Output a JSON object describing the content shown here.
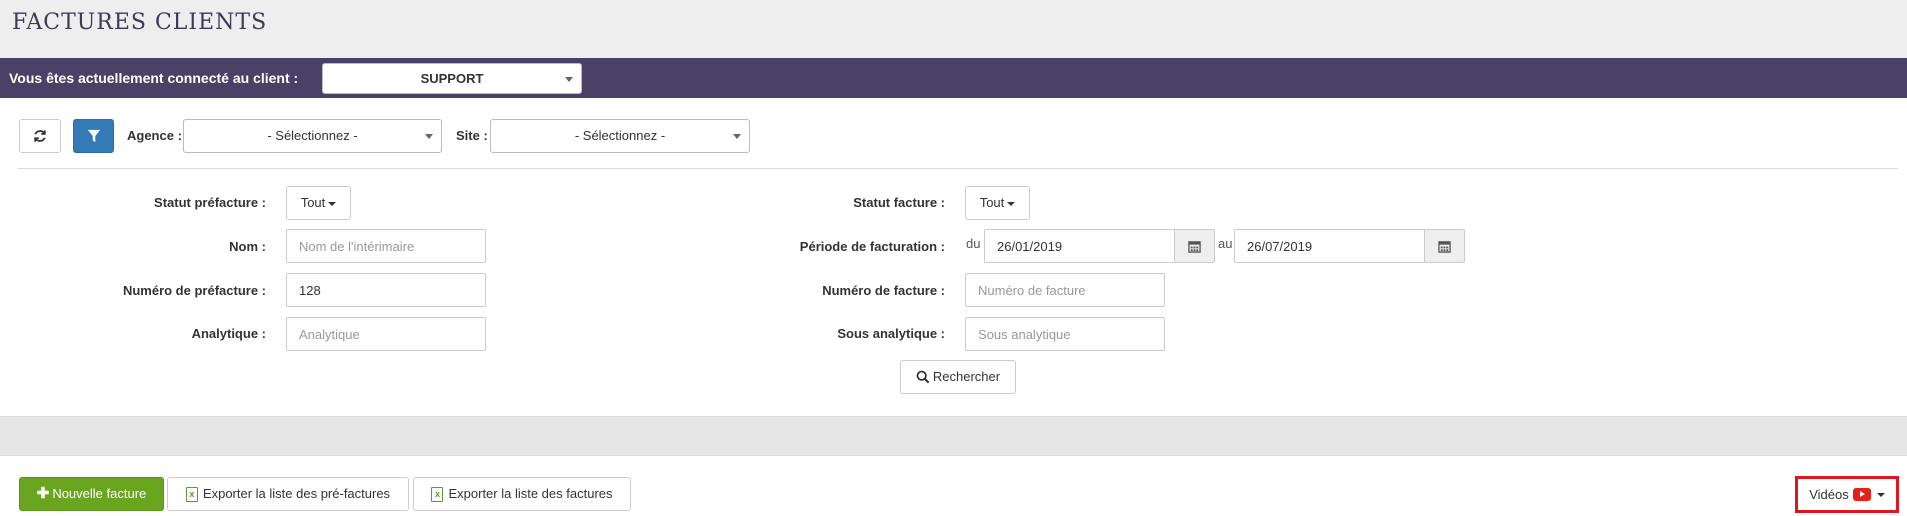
{
  "header": {
    "title": "FACTURES CLIENTS"
  },
  "client_bar": {
    "label": "Vous êtes actuellement connecté au client :",
    "client": "SUPPORT"
  },
  "toolbar": {
    "refresh_icon": "refresh-icon",
    "filter_icon": "filter-icon",
    "agence_label": "Agence :",
    "agence_value": "- Sélectionnez -",
    "site_label": "Site :",
    "site_value": "- Sélectionnez -"
  },
  "filters": {
    "statut_prefacture_label": "Statut préfacture :",
    "statut_prefacture_value": "Tout",
    "nom_label": "Nom :",
    "nom_placeholder": "Nom de l'intérimaire",
    "numero_prefacture_label": "Numéro de préfacture :",
    "numero_prefacture_value": "128",
    "analytique_label": "Analytique :",
    "analytique_placeholder": "Analytique",
    "statut_facture_label": "Statut facture :",
    "statut_facture_value": "Tout",
    "periode_label": "Période de facturation :",
    "du": "du",
    "date_from": "26/01/2019",
    "au": "au",
    "date_to": "26/07/2019",
    "numero_facture_label": "Numéro de facture :",
    "numero_facture_placeholder": "Numéro de facture",
    "sous_analytique_label": "Sous analytique :",
    "sous_analytique_placeholder": "Sous analytique",
    "search_label": "Rechercher"
  },
  "actions": {
    "new_invoice": "Nouvelle facture",
    "export_prefactures": "Exporter la liste des pré-factures",
    "export_factures": "Exporter la liste des factures",
    "videos": "Vidéos"
  },
  "colors": {
    "client_bar": "#4a4266",
    "primary": "#337ab7",
    "success": "#6aa51f",
    "highlight": "#e0161e"
  }
}
